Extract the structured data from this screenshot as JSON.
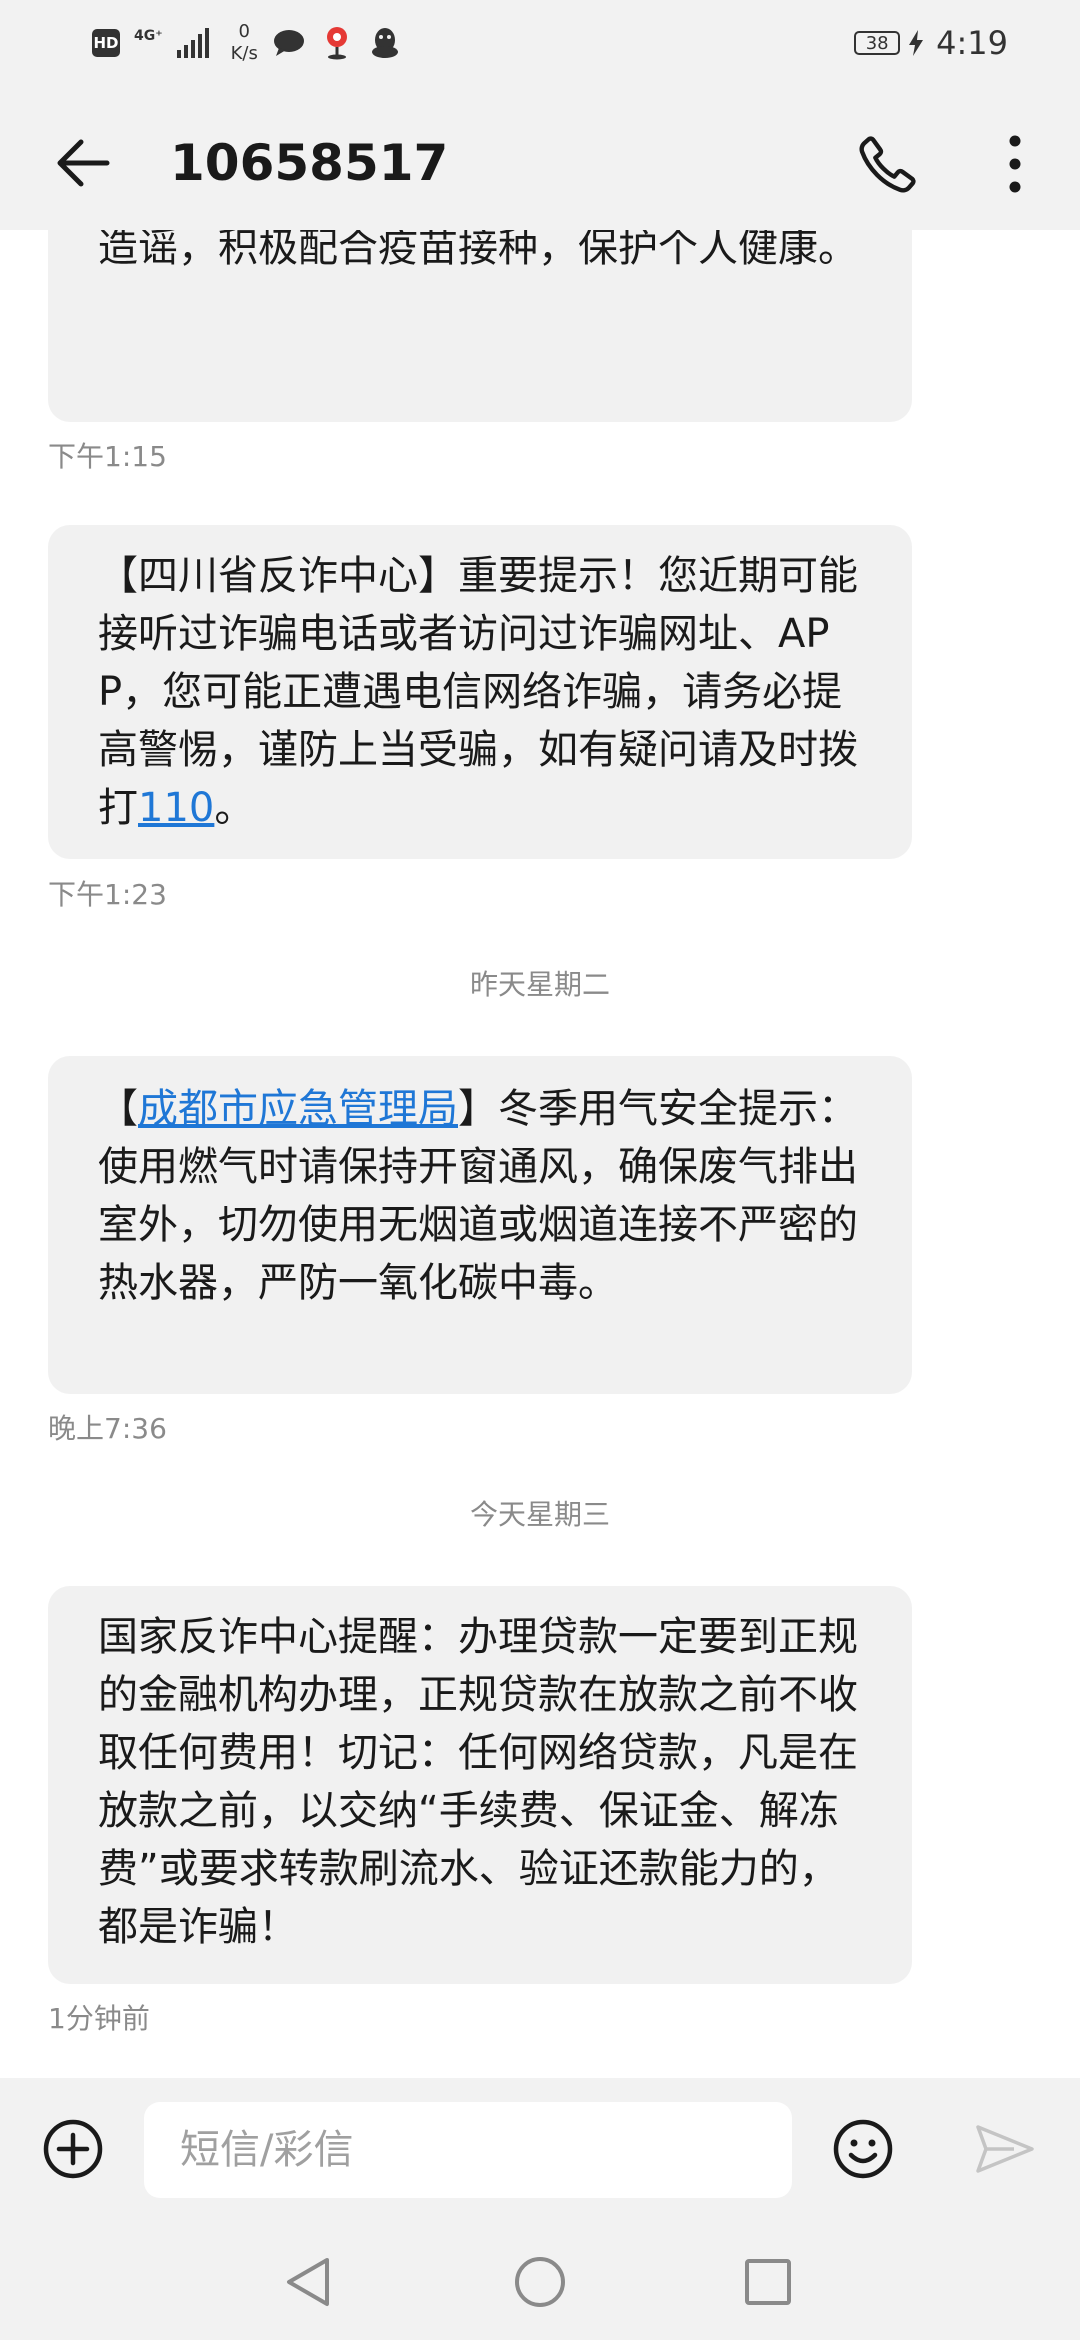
{
  "status_bar": {
    "hd": "HD",
    "network": "4G⁺",
    "speed_value": "0",
    "speed_unit": "K/s",
    "battery": "38",
    "time": "4:19"
  },
  "header": {
    "title": "10658517"
  },
  "messages": [
    {
      "text": "动学习疫情防控知识，不信谣、不传谣、不造谣，积极配合疫苗接种，保护个人健康。",
      "time": "下午1:15"
    },
    {
      "text_before": "【四川省反诈中心】重要提示！您近期可能接听过诈骗电话或者访问过诈骗网址、APP，您可能正遭遇电信网络诈骗，请务必提高警惕，谨防上当受骗，如有疑问请及时拨打",
      "link": "110",
      "text_after": "。",
      "time": "下午1:23"
    },
    {
      "date_separator": "昨天星期二",
      "text_before": "【",
      "link": "成都市应急管理局",
      "text_after": "】冬季用气安全提示：使用燃气时请保持开窗通风，确保废气排出室外，切勿使用无烟道或烟道连接不严密的热水器，严防一氧化碳中毒。",
      "time": "晚上7:36"
    },
    {
      "date_separator": "今天星期三",
      "text": "国家反诈中心提醒：办理贷款一定要到正规的金融机构办理，正规贷款在放款之前不收取任何费用！切记：任何网络贷款，凡是在放款之前，以交纳“手续费、保证金、解冻费”或要求转款刷流水、验证还款能力的，都是诈骗！",
      "time": "1分钟前"
    }
  ],
  "input": {
    "placeholder": "短信/彩信"
  },
  "colors": {
    "bar_background": "#f2f2f2",
    "bubble_background": "#f1f1f1",
    "link": "#1f77d6",
    "timestamp": "#8a8a8a"
  }
}
